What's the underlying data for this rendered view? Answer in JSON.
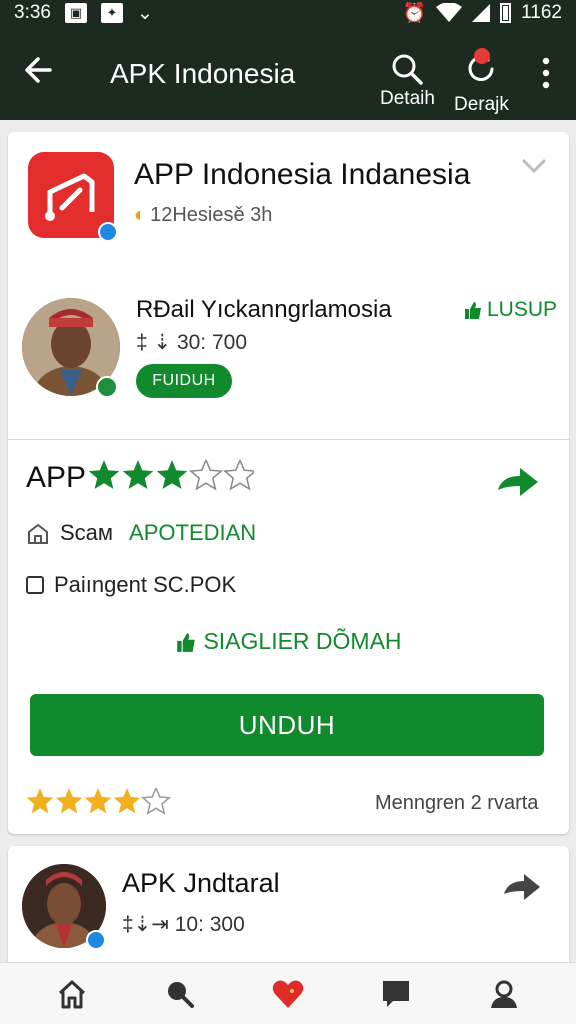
{
  "status_bar": {
    "time": "3:36",
    "battery_text": "1162"
  },
  "app_bar": {
    "title": "APK Indonesia",
    "actions": [
      {
        "label": "Detaih",
        "icon": "search-icon"
      },
      {
        "label": "Derajk",
        "icon": "refresh-icon"
      }
    ]
  },
  "app_card": {
    "title": "APP Indonesia Indanesia",
    "subtitle": "12Hesiesě 3h",
    "developer": {
      "name": "RĐail Yıckanngrlamosia",
      "price": "‡ ⇣ 30: 700",
      "button_label": "FUIDUH",
      "like_label": "LUSUP"
    },
    "rating": {
      "label": "APP",
      "value": 3.5,
      "max": 5
    },
    "info": [
      {
        "label": "Scaм",
        "value": "APOTEDIAN"
      },
      {
        "label": "Paiıngent SC.POK",
        "value": ""
      }
    ],
    "suggest_label": "SIAGLIER DÕMAH",
    "download_label": "UNDUH",
    "bottom_rating": {
      "value": 4,
      "max": 5
    },
    "reviews_text": "Menngren 2 rvarta"
  },
  "second_card": {
    "title": "APK Jndtaral",
    "price": "‡⇣⇥ 10: 300"
  },
  "bottom_nav": [
    "home-icon",
    "search-icon",
    "heart-icon",
    "chat-icon",
    "profile-icon"
  ],
  "colors": {
    "bar_bg": "#1d2a20",
    "accent_green": "#11892d",
    "icon_red": "#e32c2c",
    "verified_blue": "#1e88e5"
  }
}
